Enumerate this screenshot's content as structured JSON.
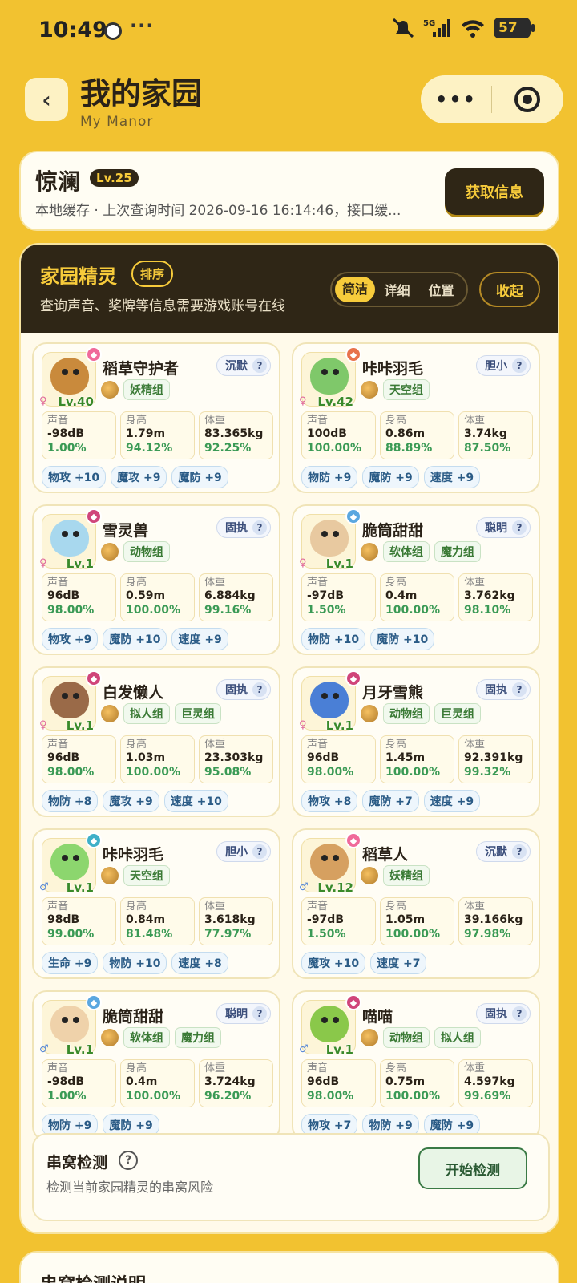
{
  "status_bar": {
    "time": "10:49",
    "more": "···",
    "battery": "57"
  },
  "header": {
    "back": "‹",
    "title": "我的家园",
    "subtitle": "My Manor",
    "menu": "•••"
  },
  "profile": {
    "name": "惊澜",
    "level": "Lv.25",
    "info": "本地缓存 · 上次查询时间 2026-09-16 16:14:46，接口缓...",
    "fetch_button": "获取信息"
  },
  "panel": {
    "title": "家园精灵",
    "sort_button": "排序",
    "subtitle": "查询声音、奖牌等信息需要游戏账号在线",
    "views": [
      "简洁",
      "详细",
      "位置"
    ],
    "active_view": "简洁",
    "collapse_button": "收起",
    "stat_labels": {
      "sound": "声音",
      "height": "身高",
      "weight": "体重"
    },
    "sprites": [
      {
        "name": "稻草守护者",
        "level": "Lv.40",
        "gender": "♀",
        "nature": "沉默",
        "eggs": [
          "妖精组"
        ],
        "color": "#c98a3c",
        "badge_color": "#f06a9a",
        "stats": [
          [
            "-98dB",
            "1.00%"
          ],
          [
            "1.79m",
            "94.12%"
          ],
          [
            "83.365kg",
            "92.25%"
          ]
        ],
        "bonuses": [
          "物攻 +10",
          "魔攻 +9",
          "魔防 +9"
        ]
      },
      {
        "name": "咔咔羽毛",
        "level": "Lv.42",
        "gender": "♀",
        "nature": "胆小",
        "eggs": [
          "天空组"
        ],
        "color": "#7fc86a",
        "badge_color": "#e8724c",
        "stats": [
          [
            "100dB",
            "100.00%"
          ],
          [
            "0.86m",
            "88.89%"
          ],
          [
            "3.74kg",
            "87.50%"
          ]
        ],
        "bonuses": [
          "物防 +9",
          "魔防 +9",
          "速度 +9"
        ]
      },
      {
        "name": "雪灵兽",
        "level": "Lv.1",
        "gender": "♀",
        "nature": "固执",
        "eggs": [
          "动物组"
        ],
        "color": "#a8d8ee",
        "badge_color": "#d0457a",
        "stats": [
          [
            "96dB",
            "98.00%"
          ],
          [
            "0.59m",
            "100.00%"
          ],
          [
            "6.884kg",
            "99.16%"
          ]
        ],
        "bonuses": [
          "物攻 +9",
          "魔防 +10",
          "速度 +9"
        ]
      },
      {
        "name": "脆筒甜甜",
        "level": "Lv.1",
        "gender": "♀",
        "nature": "聪明",
        "eggs": [
          "软体组",
          "魔力组"
        ],
        "color": "#e8c9a0",
        "badge_color": "#5aa7e0",
        "stats": [
          [
            "-97dB",
            "1.50%"
          ],
          [
            "0.4m",
            "100.00%"
          ],
          [
            "3.762kg",
            "98.10%"
          ]
        ],
        "bonuses": [
          "物防 +10",
          "魔防 +10"
        ]
      },
      {
        "name": "白发懒人",
        "level": "Lv.1",
        "gender": "♀",
        "nature": "固执",
        "eggs": [
          "拟人组",
          "巨灵组"
        ],
        "color": "#9a6a48",
        "badge_color": "#d0457a",
        "stats": [
          [
            "96dB",
            "98.00%"
          ],
          [
            "1.03m",
            "100.00%"
          ],
          [
            "23.303kg",
            "95.08%"
          ]
        ],
        "bonuses": [
          "物防 +8",
          "魔攻 +9",
          "速度 +10"
        ]
      },
      {
        "name": "月牙雪熊",
        "level": "Lv.1",
        "gender": "♀",
        "nature": "固执",
        "eggs": [
          "动物组",
          "巨灵组"
        ],
        "color": "#4a7fd6",
        "badge_color": "#d0457a",
        "stats": [
          [
            "96dB",
            "98.00%"
          ],
          [
            "1.45m",
            "100.00%"
          ],
          [
            "92.391kg",
            "99.32%"
          ]
        ],
        "bonuses": [
          "物攻 +8",
          "魔防 +7",
          "速度 +9"
        ]
      },
      {
        "name": "咔咔羽毛",
        "level": "Lv.1",
        "gender": "♂",
        "nature": "胆小",
        "eggs": [
          "天空组"
        ],
        "color": "#8cd66e",
        "badge_color": "#3fb0c8",
        "stats": [
          [
            "98dB",
            "99.00%"
          ],
          [
            "0.84m",
            "81.48%"
          ],
          [
            "3.618kg",
            "77.97%"
          ]
        ],
        "bonuses": [
          "生命 +9",
          "物防 +10",
          "速度 +8"
        ]
      },
      {
        "name": "稻草人",
        "level": "Lv.12",
        "gender": "♂",
        "nature": "沉默",
        "eggs": [
          "妖精组"
        ],
        "color": "#d6a060",
        "badge_color": "#f06a9a",
        "stats": [
          [
            "-97dB",
            "1.50%"
          ],
          [
            "1.05m",
            "100.00%"
          ],
          [
            "39.166kg",
            "97.98%"
          ]
        ],
        "bonuses": [
          "魔攻 +10",
          "速度 +7"
        ]
      },
      {
        "name": "脆筒甜甜",
        "level": "Lv.1",
        "gender": "♂",
        "nature": "聪明",
        "eggs": [
          "软体组",
          "魔力组"
        ],
        "color": "#efd2aa",
        "badge_color": "#5aa7e0",
        "stats": [
          [
            "-98dB",
            "1.00%"
          ],
          [
            "0.4m",
            "100.00%"
          ],
          [
            "3.724kg",
            "96.20%"
          ]
        ],
        "bonuses": [
          "物防 +9",
          "魔防 +9"
        ]
      },
      {
        "name": "喵喵",
        "level": "Lv.1",
        "gender": "♂",
        "nature": "固执",
        "eggs": [
          "动物组",
          "拟人组"
        ],
        "color": "#8ac84a",
        "badge_color": "#d0457a",
        "stats": [
          [
            "96dB",
            "98.00%"
          ],
          [
            "0.75m",
            "100.00%"
          ],
          [
            "4.597kg",
            "99.69%"
          ]
        ],
        "bonuses": [
          "物攻 +7",
          "物防 +9",
          "魔防 +9"
        ]
      }
    ]
  },
  "detect": {
    "title": "串窝检测",
    "desc": "检测当前家园精灵的串窝风险",
    "button": "开始检测"
  },
  "explain": {
    "title": "串窝检测说明"
  },
  "colors": {
    "background": "#f2c230",
    "dark": "#2f2616",
    "accent": "#f7cb3b"
  }
}
